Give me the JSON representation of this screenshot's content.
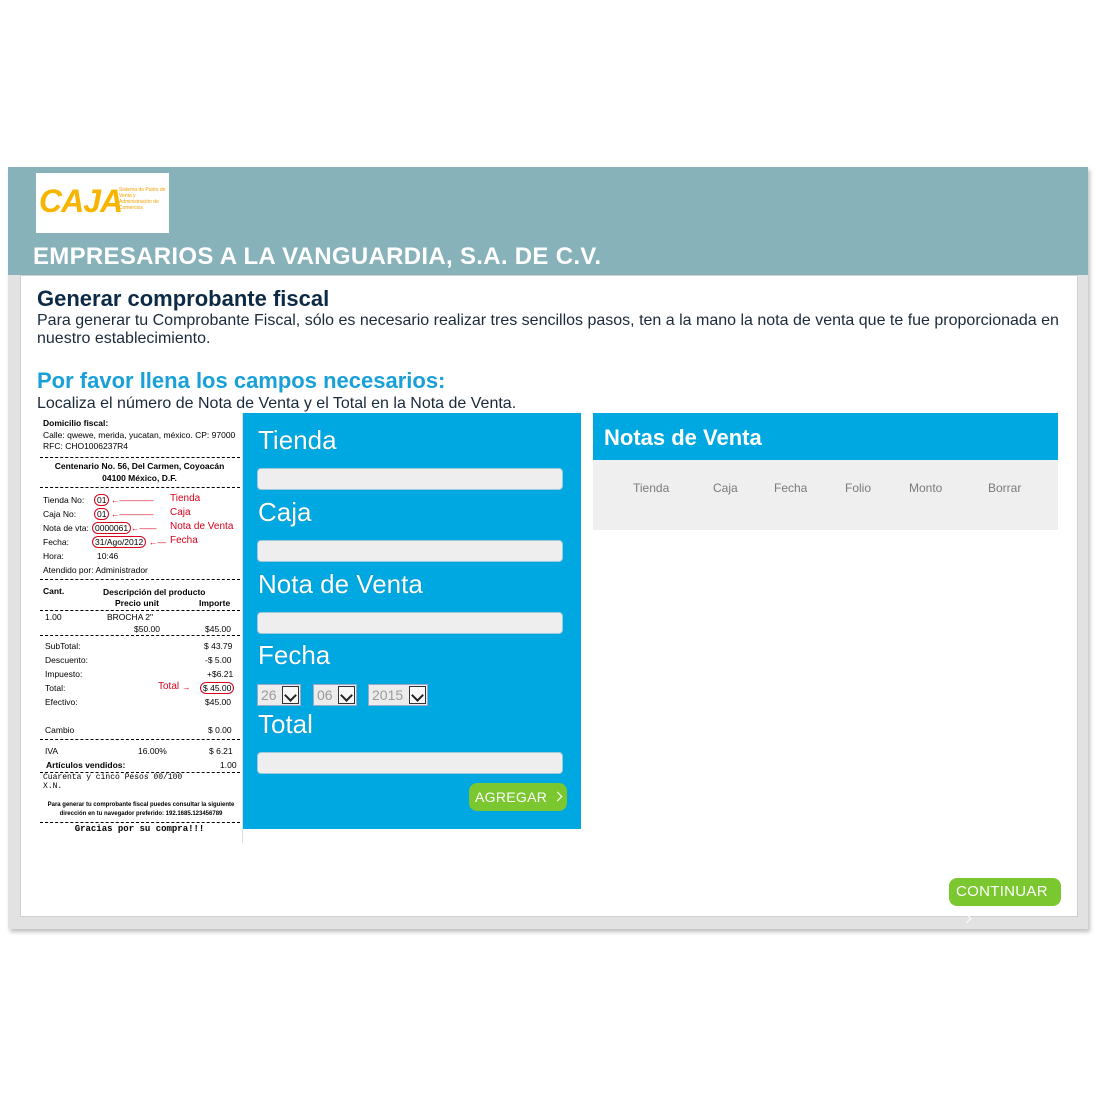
{
  "header": {
    "logo_word": "CAJA",
    "logo_tagline": "Sistema de Punto de Venta y Administración de Comercios",
    "company": "EMPRESARIOS A LA VANGUARDIA, S.A. DE C.V."
  },
  "main": {
    "title": "Generar comprobante fiscal",
    "description": "Para generar tu Comprobante Fiscal, sólo es necesario realizar tres sencillos pasos, ten a la mano la nota de venta que te fue proporcionada en nuestro establecimiento.",
    "subtitle": "Por favor llena los campos necesarios:",
    "hint": "Localiza el número de Nota de Venta y el Total en la Nota de Venta."
  },
  "receipt": {
    "fiscal_label": "Domicilio fiscal:",
    "fiscal_address": "Calle: qwewe, merida, yucatan, méxico. CP: 97000",
    "rfc": "RFC: CHO1006237R4",
    "store_address_1": "Centenario No. 56, Del Carmen, Coyoacán",
    "store_address_2": "04100 México, D.F.",
    "tienda_label": "Tienda No:",
    "tienda_value": "01",
    "tienda_note": "Tienda",
    "caja_label": "Caja No:",
    "caja_value": "01",
    "caja_note": "Caja",
    "nota_label": "Nota de vta:",
    "nota_value": "0000061",
    "nota_note": "Nota de Venta",
    "fecha_label": "Fecha:",
    "fecha_value": "31/Ago/2012",
    "fecha_note": "Fecha",
    "hora_label": "Hora:",
    "hora_value": "10:46",
    "atendido": "Atendido por: Administrador",
    "col_cant": "Cant.",
    "col_desc": "Descripción del producto",
    "col_precio": "Precio unit",
    "col_importe": "Importe",
    "item_qty": "1.00",
    "item_name": "BROCHA 2\"",
    "item_price": "$50.00",
    "item_amount": "$45.00",
    "subtotal_label": "SubTotal:",
    "subtotal_value": "$ 43.79",
    "descuento_label": "Descuento:",
    "descuento_value": "-$ 5.00",
    "impuesto_label": "Impuesto:",
    "impuesto_value": "+$6.21",
    "total_label": "Total:",
    "total_note": "Total",
    "total_value": "$ 45.00",
    "efectivo_label": "Efectivo:",
    "efectivo_value": "$45.00",
    "cambio_label": "Cambio",
    "cambio_value": "$ 0.00",
    "iva_label": "IVA",
    "iva_rate": "16.00%",
    "iva_value": "$ 6.21",
    "articulos_label": "Artículos vendidos:",
    "articulos_value": "1.00",
    "amount_words_1": "Cuarenta y cinco Pesos 00/100",
    "amount_words_2": "X.N.",
    "footer_note": "Para generar tu comprobante fiscal puedes consultar la siguiente dirección en tu navegador preferido: 192.1685.123456789",
    "thanks": "Gracias por su compra!!!"
  },
  "form": {
    "tienda_label": "Tienda",
    "tienda_value": "",
    "caja_label": "Caja",
    "caja_value": "",
    "nota_label": "Nota de Venta",
    "nota_value": "",
    "fecha_label": "Fecha",
    "day": "26",
    "month": "06",
    "year": "2015",
    "total_label": "Total",
    "total_value": "",
    "add_button": "AGREGAR"
  },
  "notas": {
    "title": "Notas de Venta",
    "columns": [
      "Tienda",
      "Caja",
      "Fecha",
      "Folio",
      "Monto",
      "Borrar"
    ]
  },
  "footer": {
    "continue_button": "CONTINUAR"
  },
  "colors": {
    "header_bg": "#88b2b9",
    "accent_blue": "#00a8e1",
    "button_green": "#7ac72f",
    "title_blue": "#19a0d8"
  }
}
